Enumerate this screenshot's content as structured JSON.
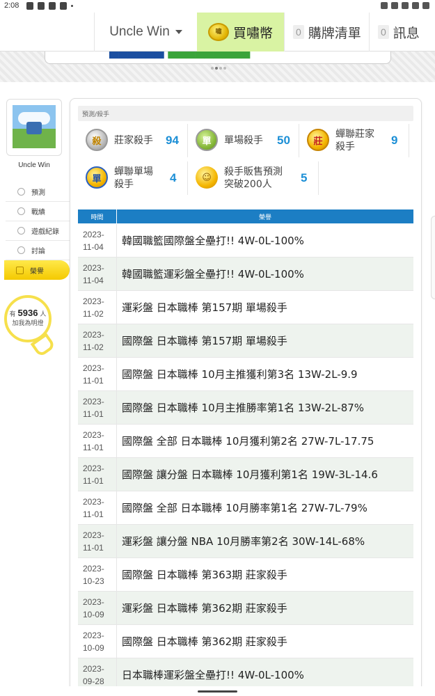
{
  "status": {
    "time": "2:08"
  },
  "nav": {
    "user": "Uncle Win",
    "buy_label": "買嘯幣",
    "buy_coin": "嘯",
    "cart_count": "0",
    "cart_label": "購牌清單",
    "msg_count": "0",
    "msg_label": "訊息"
  },
  "sidebar": {
    "username": "Uncle Win",
    "items": [
      {
        "label": "預測"
      },
      {
        "label": "戰績"
      },
      {
        "label": "遊戲紀錄"
      },
      {
        "label": "討論"
      },
      {
        "label": "榮譽"
      }
    ],
    "fans_prefix": "有",
    "fans_count": "5936",
    "fans_suffix": "人",
    "fans_text": "加我為明燈"
  },
  "breadcrumb": "預測/殺手",
  "honors": [
    {
      "label": "莊家殺手",
      "count": "94",
      "glyph": "殺"
    },
    {
      "label": "單場殺手",
      "count": "50",
      "glyph": "單"
    },
    {
      "label_line1": "蟬聯莊家",
      "label_line2": "殺手",
      "count": "9",
      "glyph": "莊"
    },
    {
      "label_line1": "蟬聯單場",
      "label_line2": "殺手",
      "count": "4",
      "glyph": "單"
    },
    {
      "label_line1": "殺手販售預測",
      "label_line2": "突破200人",
      "count": "5",
      "glyph": "☺"
    }
  ],
  "table": {
    "col_time": "時間",
    "col_honor": "榮譽",
    "rows": [
      {
        "year": "2023-",
        "md": "11-04",
        "text": "韓國職籃國際盤全壘打!! 4W-0L-100%"
      },
      {
        "year": "2023-",
        "md": "11-04",
        "text": "韓國職籃運彩盤全壘打!! 4W-0L-100%"
      },
      {
        "year": "2023-",
        "md": "11-02",
        "text": "運彩盤 日本職棒 第157期 單場殺手"
      },
      {
        "year": "2023-",
        "md": "11-02",
        "text": "國際盤 日本職棒 第157期 單場殺手"
      },
      {
        "year": "2023-",
        "md": "11-01",
        "text": "國際盤 日本職棒 10月主推獲利第3名 13W-2L-9.9"
      },
      {
        "year": "2023-",
        "md": "11-01",
        "text": "國際盤 日本職棒 10月主推勝率第1名 13W-2L-87%"
      },
      {
        "year": "2023-",
        "md": "11-01",
        "text": "國際盤 全部 日本職棒 10月獲利第2名 27W-7L-17.75"
      },
      {
        "year": "2023-",
        "md": "11-01",
        "text": "國際盤 讓分盤 日本職棒 10月獲利第1名 19W-3L-14.6"
      },
      {
        "year": "2023-",
        "md": "11-01",
        "text": "國際盤 全部 日本職棒 10月勝率第1名 27W-7L-79%"
      },
      {
        "year": "2023-",
        "md": "11-01",
        "text": "運彩盤 讓分盤 NBA 10月勝率第2名 30W-14L-68%"
      },
      {
        "year": "2023-",
        "md": "10-23",
        "text": "國際盤 日本職棒 第363期 莊家殺手"
      },
      {
        "year": "2023-",
        "md": "10-09",
        "text": "運彩盤 日本職棒 第362期 莊家殺手"
      },
      {
        "year": "2023-",
        "md": "10-09",
        "text": "國際盤 日本職棒 第362期 莊家殺手"
      },
      {
        "year": "2023-",
        "md": "09-28",
        "text": "日本職棒運彩盤全壘打!! 4W-0L-100%"
      }
    ]
  },
  "colors": {
    "accent_blue": "#1c7ec4",
    "count_blue": "#1c8fd6",
    "buy_green": "#d9f3a3",
    "active_yellow": "#f4c900"
  }
}
